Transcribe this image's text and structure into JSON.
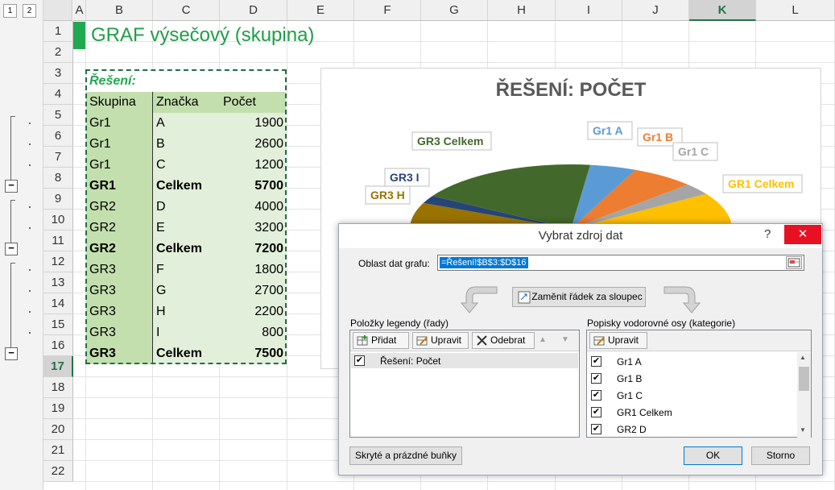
{
  "outline": {
    "level1": "1",
    "level2": "2",
    "collapse_symbol": "−"
  },
  "columns": [
    "A",
    "B",
    "C",
    "D",
    "E",
    "F",
    "G",
    "H",
    "I",
    "J",
    "K",
    "L"
  ],
  "selected_column": "K",
  "rows": [
    "1",
    "2",
    "3",
    "4",
    "5",
    "6",
    "7",
    "8",
    "9",
    "10",
    "11",
    "12",
    "13",
    "14",
    "15",
    "16",
    "17",
    "18",
    "19",
    "20",
    "21",
    "22"
  ],
  "selected_row": "17",
  "sheet_title": "GRAF výsečový (skupina)",
  "table": {
    "caption": "Řešení:",
    "headers": [
      "Skupina",
      "Značka",
      "Počet"
    ],
    "rows": [
      {
        "group": "Gr1",
        "brand": "A",
        "count": "1900",
        "bold": false
      },
      {
        "group": "Gr1",
        "brand": "B",
        "count": "2600",
        "bold": false
      },
      {
        "group": "Gr1",
        "brand": "C",
        "count": "1200",
        "bold": false
      },
      {
        "group": "GR1",
        "brand": "Celkem",
        "count": "5700",
        "bold": true
      },
      {
        "group": "GR2",
        "brand": "D",
        "count": "4000",
        "bold": false
      },
      {
        "group": "GR2",
        "brand": "E",
        "count": "3200",
        "bold": false
      },
      {
        "group": "GR2",
        "brand": "Celkem",
        "count": "7200",
        "bold": true
      },
      {
        "group": "GR3",
        "brand": "F",
        "count": "1800",
        "bold": false
      },
      {
        "group": "GR3",
        "brand": "G",
        "count": "2700",
        "bold": false
      },
      {
        "group": "GR3",
        "brand": "H",
        "count": "2200",
        "bold": false
      },
      {
        "group": "GR3",
        "brand": "I",
        "count": "800",
        "bold": false
      },
      {
        "group": "GR3",
        "brand": "Celkem",
        "count": "7500",
        "bold": true
      }
    ]
  },
  "chart_data": {
    "type": "pie",
    "title": "ŘEŠENÍ: POČET",
    "categories": [
      "Gr1 A",
      "Gr1 B",
      "Gr1 C",
      "GR1 Celkem",
      "GR2 D",
      "GR2 E",
      "GR2 Celkem",
      "GR3 F",
      "GR3 G",
      "GR3 H",
      "GR3 I",
      "GR3 Celkem"
    ],
    "values": [
      1900,
      2600,
      1200,
      5700,
      4000,
      3200,
      7200,
      1800,
      2700,
      2200,
      800,
      7500
    ],
    "colors": [
      "#5b9bd5",
      "#ed7d31",
      "#a5a5a5",
      "#ffc000",
      "#4472c4",
      "#70ad47",
      "#255e91",
      "#9e480e",
      "#636363",
      "#997300",
      "#264478",
      "#43682b"
    ],
    "visible_labels": {
      "Gr1 A": "Gr1 A",
      "Gr1 B": "Gr1 B",
      "Gr1 C": "Gr1 C",
      "GR1 Celkem": "GR1 Celkem",
      "GR3 I": "GR3 I",
      "GR3 H": "GR3 H",
      "GR3 Celkem": "GR3 Celkem"
    }
  },
  "dialog": {
    "title": "Vybrat zdroj dat",
    "help": "?",
    "close": "✕",
    "range_label": "Oblast dat grafu:",
    "range_value": "=Řešení!$B$3:$D$16",
    "switch_button": "Zaměnit řádek za sloupec",
    "legend_header": "Položky legendy (řady)",
    "add_button": "Přidat",
    "edit_button": "Upravit",
    "remove_button": "Odebrat",
    "legend_items": [
      "Řešení: Počet"
    ],
    "axis_header": "Popisky vodorovné osy (kategorie)",
    "axis_edit_button": "Upravit",
    "axis_items": [
      "Gr1 A",
      "Gr1 B",
      "Gr1 C",
      "GR1 Celkem",
      "GR2 D"
    ],
    "hidden_cells_button": "Skryté a prázdné buňky",
    "ok_button": "OK",
    "cancel_button": "Storno",
    "up_symbol": "▲",
    "down_symbol": "▼",
    "check_symbol": "✔"
  }
}
